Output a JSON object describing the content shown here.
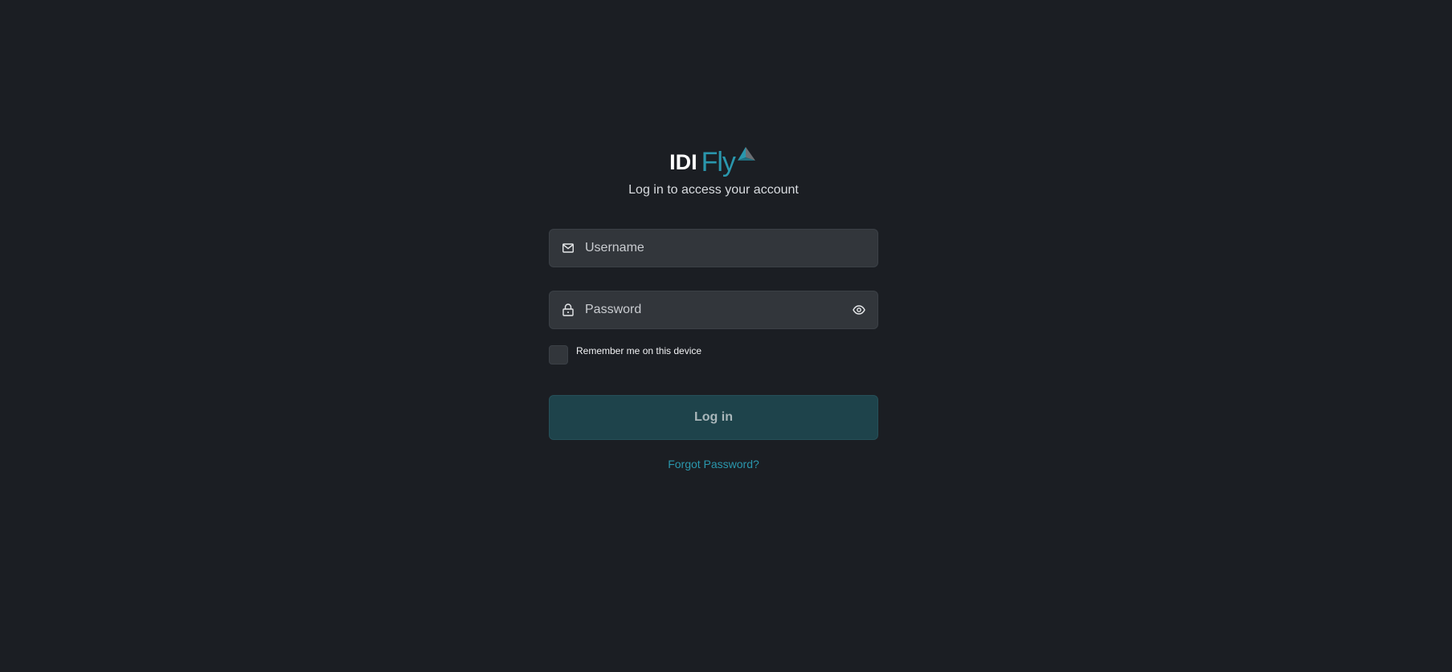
{
  "brand": {
    "logo_bold": "IDI",
    "logo_light": "Fly",
    "accent_color": "#2a97ad",
    "logo_icon": "paper-plane-icon"
  },
  "subtitle": "Log in to access your account",
  "form": {
    "username": {
      "placeholder": "Username",
      "value": "",
      "icon": "envelope-icon"
    },
    "password": {
      "placeholder": "Password",
      "value": "",
      "icon": "lock-icon",
      "toggle_icon": "eye-icon"
    },
    "remember": {
      "label": "Remember me on this device",
      "checked": false
    },
    "submit_label": "Log in",
    "forgot_label": "Forgot Password?"
  },
  "colors": {
    "background": "#1b1e23",
    "field_bg": "#32363b",
    "button_bg": "#1e434b"
  }
}
